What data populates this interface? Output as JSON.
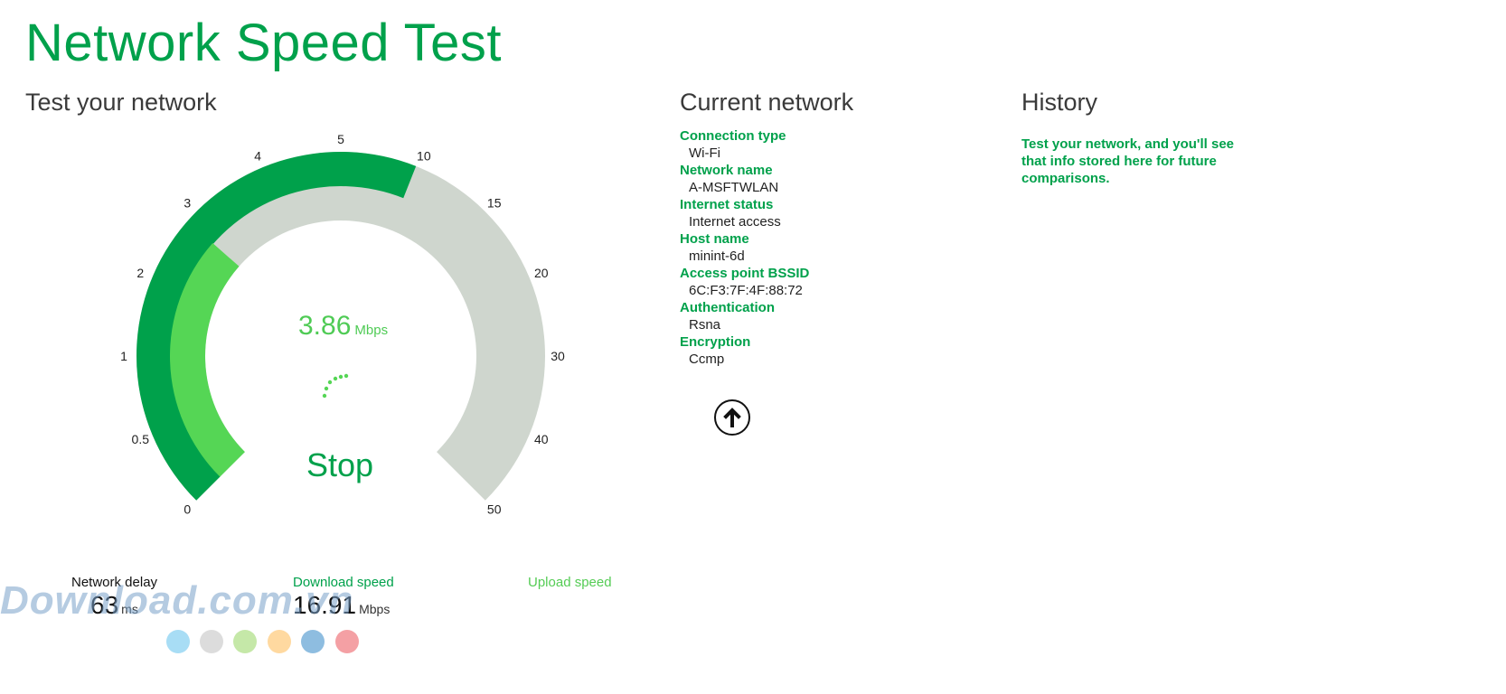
{
  "app": {
    "title": "Network Speed Test"
  },
  "test": {
    "heading": "Test your network",
    "gauge_ticks": [
      "0",
      "0.5",
      "1",
      "2",
      "3",
      "4",
      "5",
      "10",
      "15",
      "20",
      "30",
      "40",
      "50"
    ],
    "outer_progress_fraction": 0.58,
    "inner_progress_fraction": 0.32,
    "current_speed": "3.86",
    "current_speed_unit": "Mbps",
    "stop_label": "Stop"
  },
  "stats": {
    "delay_label": "Network delay",
    "delay_value": "63",
    "delay_unit": "ms",
    "download_label": "Download speed",
    "download_value": "16.91",
    "download_unit": "Mbps",
    "upload_label": "Upload speed"
  },
  "network": {
    "heading": "Current network",
    "items": [
      {
        "label": "Connection type",
        "value": "Wi-Fi"
      },
      {
        "label": "Network name",
        "value": "A-MSFTWLAN"
      },
      {
        "label": "Internet status",
        "value": "Internet access"
      },
      {
        "label": "Host name",
        "value": "minint-6d"
      },
      {
        "label": "Access point BSSID",
        "value": "6C:F3:7F:4F:88:72"
      },
      {
        "label": "Authentication",
        "value": "Rsna"
      },
      {
        "label": "Encryption",
        "value": "Ccmp"
      }
    ],
    "upload_icon": "arrow-up-circle-icon"
  },
  "history": {
    "heading": "History",
    "message": "Test your network, and you'll see that info stored here for future comparisons."
  },
  "watermark": {
    "text": "Download.com.vn"
  },
  "colors": {
    "accent": "#00A14B",
    "light_green": "#55D655",
    "track": "#CFD6CE",
    "dots": [
      "#A8DDF5",
      "#DCDCDC",
      "#C5E8A8",
      "#FFD9A0",
      "#8EBDE0",
      "#F4A0A4"
    ]
  }
}
